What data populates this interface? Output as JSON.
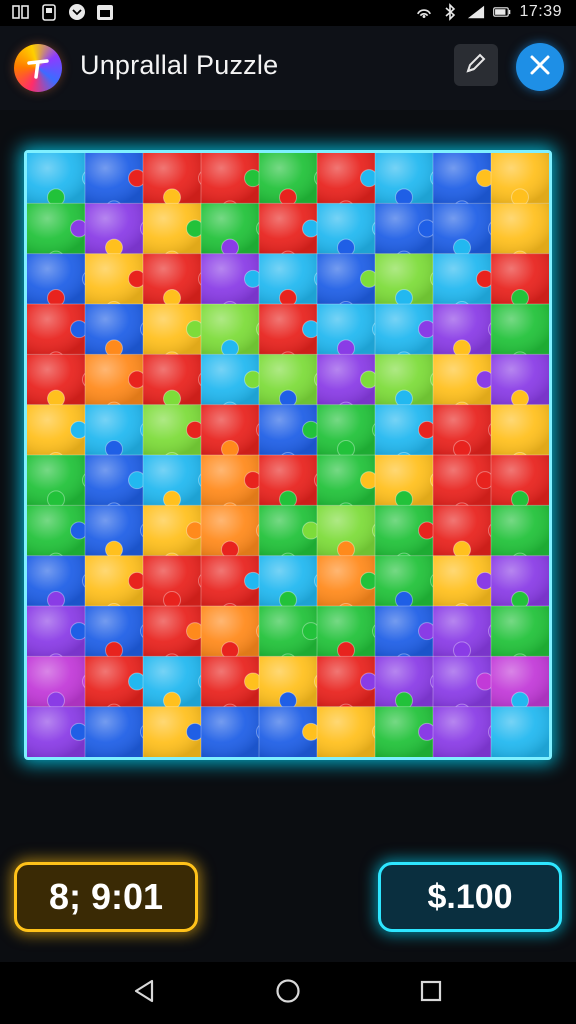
{
  "status_bar": {
    "time": "17:39",
    "left_icons": [
      "sim-icon",
      "screenshot-icon",
      "message-icon",
      "calendar-icon"
    ],
    "right_icons": [
      "hotspot-icon",
      "bluetooth-icon",
      "signal-icon",
      "battery-icon"
    ]
  },
  "header": {
    "title": "Unprallal Puzzle",
    "logo_icon": "app-logo-icon",
    "edit_icon": "edit-icon",
    "close_icon": "close-icon",
    "accent_color": "#1e8fe6"
  },
  "board": {
    "columns": 9,
    "rows": 12,
    "frame_color": "#7ff0ff",
    "palette": {
      "R": "#e8231e",
      "O": "#ff8a1c",
      "Y": "#ffc01e",
      "G": "#22c23a",
      "L": "#7ddc3a",
      "C": "#22b8f0",
      "B": "#1f5fe6",
      "P": "#8a3ce6",
      "M": "#c23ad8"
    },
    "tiles": [
      "CBRRGRCBY",
      "GPYGRCBBY",
      "BYRPCBLCR",
      "RBYLRCCPG",
      "RORCLPLYP",
      "YCLRBGCRY",
      "GBCORGYRR",
      "GBYOGLGRG",
      "BYRRCOGYP",
      "PBROGGBPG",
      "MRCRYRPPM",
      "PBYBBYGPC"
    ]
  },
  "footer": {
    "timer": "8; 9:01",
    "score": "$.100",
    "timer_color": "#ffc21a",
    "score_color": "#2ee6ff"
  },
  "nav": {
    "back_icon": "back-triangle-icon",
    "home_icon": "home-circle-icon",
    "recents_icon": "recents-square-icon"
  }
}
